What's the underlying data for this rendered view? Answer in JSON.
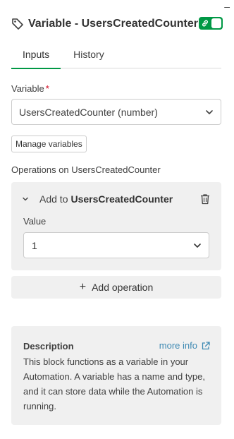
{
  "window": {
    "minimize_glyph": "–"
  },
  "header": {
    "icon": "tag-icon",
    "title": "Variable - UsersCreatedCounter",
    "toggle": {
      "state": "on",
      "color": "#009845",
      "icon": "link-icon"
    }
  },
  "tabs": [
    {
      "label": "Inputs",
      "active": true
    },
    {
      "label": "History",
      "active": false
    }
  ],
  "variable_field": {
    "label": "Variable",
    "required_mark": "*",
    "value": "UsersCreatedCounter (number)"
  },
  "manage_button": {
    "label": "Manage variables"
  },
  "operations": {
    "label": "Operations on UsersCreatedCounter",
    "items": [
      {
        "prefix": "Add to",
        "target": "UsersCreatedCounter",
        "value_label": "Value",
        "value": "1"
      }
    ],
    "add_label": "Add operation"
  },
  "description": {
    "title": "Description",
    "more_info": "more info",
    "text": "This block functions as a variable in your Automation. A variable has a name and type, and it can store data while the Automation is running."
  },
  "colors": {
    "accent": "#009845",
    "link": "#3f8ab3",
    "card_bg": "#f0f0f0",
    "required": "#d0021b"
  }
}
